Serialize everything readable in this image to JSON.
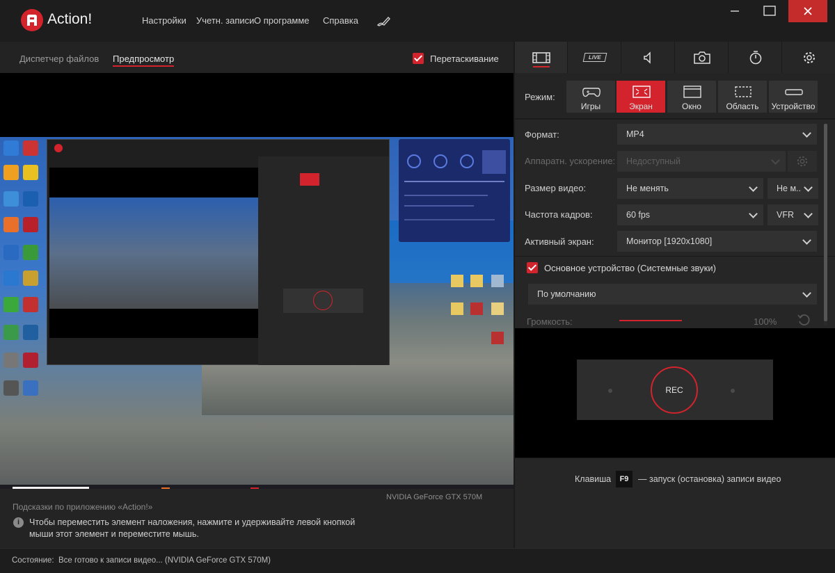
{
  "app": {
    "name": "Action!"
  },
  "menu": [
    "Настройки",
    "Учетн. записи",
    "О программе",
    "Справка"
  ],
  "left": {
    "tabs": [
      "Диспетчер файлов",
      "Предпросмотр"
    ],
    "active_tab": "Предпросмотр",
    "drag_checkbox": {
      "label": "Перетаскивание",
      "checked": true
    }
  },
  "hints": {
    "title": "Подсказки по приложению «Action!»",
    "gpu": "NVIDIA GeForce GTX 570M",
    "text": "Чтобы переместить элемент наложения, нажмите и удерживайте левой кнопкой мыши этот элемент и переместите мышь."
  },
  "right": {
    "tab_icons": [
      "film-icon",
      "live-icon",
      "speaker-icon",
      "camera-icon",
      "timer-icon",
      "gear-icon"
    ],
    "live_label": "LIVE",
    "mode": {
      "label": "Режим:",
      "options": [
        "Игры",
        "Экран",
        "Окно",
        "Область",
        "Устройство"
      ],
      "selected": "Экран"
    },
    "format": {
      "label": "Формат:",
      "value": "MP4"
    },
    "hw_accel": {
      "label": "Аппаратн. ускорение:",
      "value": "Недоступный"
    },
    "video_size": {
      "label": "Размер видео:",
      "value": "Не менять",
      "value2": "Не м..."
    },
    "fps": {
      "label": "Частота кадров:",
      "value": "60 fps",
      "mode": "VFR"
    },
    "screen": {
      "label": "Активный экран:",
      "value": "Монитор [1920x1080]"
    },
    "audio": {
      "label": "Основное устройство (Системные звуки)",
      "checked": true,
      "device": "По умолчанию"
    },
    "volume": {
      "label": "Громкость:",
      "value": "100%"
    },
    "rec_label": "REC",
    "hotkey": {
      "prefix": "Клавиша",
      "key": "F9",
      "suffix": "— запуск (остановка) записи видео"
    }
  },
  "status": {
    "label": "Состояние:",
    "text": "Все готово к записи видео... (NVIDIA GeForce GTX 570M)"
  },
  "colors": {
    "accent": "#d3232c",
    "bg": "#1b1b1b"
  }
}
